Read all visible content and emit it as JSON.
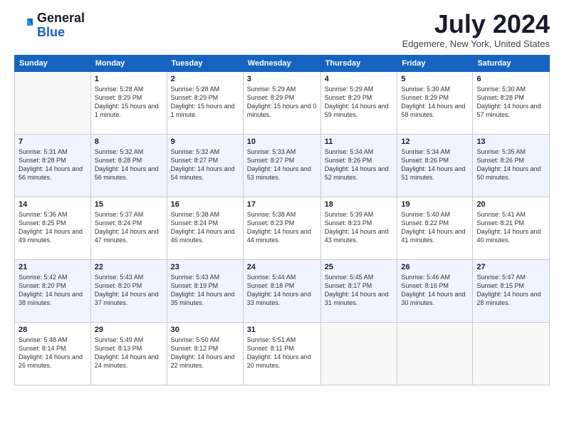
{
  "logo": {
    "general": "General",
    "blue": "Blue"
  },
  "title": "July 2024",
  "location": "Edgemere, New York, United States",
  "weekdays": [
    "Sunday",
    "Monday",
    "Tuesday",
    "Wednesday",
    "Thursday",
    "Friday",
    "Saturday"
  ],
  "weeks": [
    [
      {
        "day": "",
        "sunrise": "",
        "sunset": "",
        "daylight": ""
      },
      {
        "day": "1",
        "sunrise": "Sunrise: 5:28 AM",
        "sunset": "Sunset: 8:29 PM",
        "daylight": "Daylight: 15 hours and 1 minute."
      },
      {
        "day": "2",
        "sunrise": "Sunrise: 5:28 AM",
        "sunset": "Sunset: 8:29 PM",
        "daylight": "Daylight: 15 hours and 1 minute."
      },
      {
        "day": "3",
        "sunrise": "Sunrise: 5:29 AM",
        "sunset": "Sunset: 8:29 PM",
        "daylight": "Daylight: 15 hours and 0 minutes."
      },
      {
        "day": "4",
        "sunrise": "Sunrise: 5:29 AM",
        "sunset": "Sunset: 8:29 PM",
        "daylight": "Daylight: 14 hours and 59 minutes."
      },
      {
        "day": "5",
        "sunrise": "Sunrise: 5:30 AM",
        "sunset": "Sunset: 8:29 PM",
        "daylight": "Daylight: 14 hours and 58 minutes."
      },
      {
        "day": "6",
        "sunrise": "Sunrise: 5:30 AM",
        "sunset": "Sunset: 8:28 PM",
        "daylight": "Daylight: 14 hours and 57 minutes."
      }
    ],
    [
      {
        "day": "7",
        "sunrise": "Sunrise: 5:31 AM",
        "sunset": "Sunset: 8:28 PM",
        "daylight": "Daylight: 14 hours and 56 minutes."
      },
      {
        "day": "8",
        "sunrise": "Sunrise: 5:32 AM",
        "sunset": "Sunset: 8:28 PM",
        "daylight": "Daylight: 14 hours and 56 minutes."
      },
      {
        "day": "9",
        "sunrise": "Sunrise: 5:32 AM",
        "sunset": "Sunset: 8:27 PM",
        "daylight": "Daylight: 14 hours and 54 minutes."
      },
      {
        "day": "10",
        "sunrise": "Sunrise: 5:33 AM",
        "sunset": "Sunset: 8:27 PM",
        "daylight": "Daylight: 14 hours and 53 minutes."
      },
      {
        "day": "11",
        "sunrise": "Sunrise: 5:34 AM",
        "sunset": "Sunset: 8:26 PM",
        "daylight": "Daylight: 14 hours and 52 minutes."
      },
      {
        "day": "12",
        "sunrise": "Sunrise: 5:34 AM",
        "sunset": "Sunset: 8:26 PM",
        "daylight": "Daylight: 14 hours and 51 minutes."
      },
      {
        "day": "13",
        "sunrise": "Sunrise: 5:35 AM",
        "sunset": "Sunset: 8:26 PM",
        "daylight": "Daylight: 14 hours and 50 minutes."
      }
    ],
    [
      {
        "day": "14",
        "sunrise": "Sunrise: 5:36 AM",
        "sunset": "Sunset: 8:25 PM",
        "daylight": "Daylight: 14 hours and 49 minutes."
      },
      {
        "day": "15",
        "sunrise": "Sunrise: 5:37 AM",
        "sunset": "Sunset: 8:24 PM",
        "daylight": "Daylight: 14 hours and 47 minutes."
      },
      {
        "day": "16",
        "sunrise": "Sunrise: 5:38 AM",
        "sunset": "Sunset: 8:24 PM",
        "daylight": "Daylight: 14 hours and 46 minutes."
      },
      {
        "day": "17",
        "sunrise": "Sunrise: 5:38 AM",
        "sunset": "Sunset: 8:23 PM",
        "daylight": "Daylight: 14 hours and 44 minutes."
      },
      {
        "day": "18",
        "sunrise": "Sunrise: 5:39 AM",
        "sunset": "Sunset: 8:23 PM",
        "daylight": "Daylight: 14 hours and 43 minutes."
      },
      {
        "day": "19",
        "sunrise": "Sunrise: 5:40 AM",
        "sunset": "Sunset: 8:22 PM",
        "daylight": "Daylight: 14 hours and 41 minutes."
      },
      {
        "day": "20",
        "sunrise": "Sunrise: 5:41 AM",
        "sunset": "Sunset: 8:21 PM",
        "daylight": "Daylight: 14 hours and 40 minutes."
      }
    ],
    [
      {
        "day": "21",
        "sunrise": "Sunrise: 5:42 AM",
        "sunset": "Sunset: 8:20 PM",
        "daylight": "Daylight: 14 hours and 38 minutes."
      },
      {
        "day": "22",
        "sunrise": "Sunrise: 5:43 AM",
        "sunset": "Sunset: 8:20 PM",
        "daylight": "Daylight: 14 hours and 37 minutes."
      },
      {
        "day": "23",
        "sunrise": "Sunrise: 5:43 AM",
        "sunset": "Sunset: 8:19 PM",
        "daylight": "Daylight: 14 hours and 35 minutes."
      },
      {
        "day": "24",
        "sunrise": "Sunrise: 5:44 AM",
        "sunset": "Sunset: 8:18 PM",
        "daylight": "Daylight: 14 hours and 33 minutes."
      },
      {
        "day": "25",
        "sunrise": "Sunrise: 5:45 AM",
        "sunset": "Sunset: 8:17 PM",
        "daylight": "Daylight: 14 hours and 31 minutes."
      },
      {
        "day": "26",
        "sunrise": "Sunrise: 5:46 AM",
        "sunset": "Sunset: 8:16 PM",
        "daylight": "Daylight: 14 hours and 30 minutes."
      },
      {
        "day": "27",
        "sunrise": "Sunrise: 5:47 AM",
        "sunset": "Sunset: 8:15 PM",
        "daylight": "Daylight: 14 hours and 28 minutes."
      }
    ],
    [
      {
        "day": "28",
        "sunrise": "Sunrise: 5:48 AM",
        "sunset": "Sunset: 8:14 PM",
        "daylight": "Daylight: 14 hours and 26 minutes."
      },
      {
        "day": "29",
        "sunrise": "Sunrise: 5:49 AM",
        "sunset": "Sunset: 8:13 PM",
        "daylight": "Daylight: 14 hours and 24 minutes."
      },
      {
        "day": "30",
        "sunrise": "Sunrise: 5:50 AM",
        "sunset": "Sunset: 8:12 PM",
        "daylight": "Daylight: 14 hours and 22 minutes."
      },
      {
        "day": "31",
        "sunrise": "Sunrise: 5:51 AM",
        "sunset": "Sunset: 8:11 PM",
        "daylight": "Daylight: 14 hours and 20 minutes."
      },
      {
        "day": "",
        "sunrise": "",
        "sunset": "",
        "daylight": ""
      },
      {
        "day": "",
        "sunrise": "",
        "sunset": "",
        "daylight": ""
      },
      {
        "day": "",
        "sunrise": "",
        "sunset": "",
        "daylight": ""
      }
    ]
  ]
}
